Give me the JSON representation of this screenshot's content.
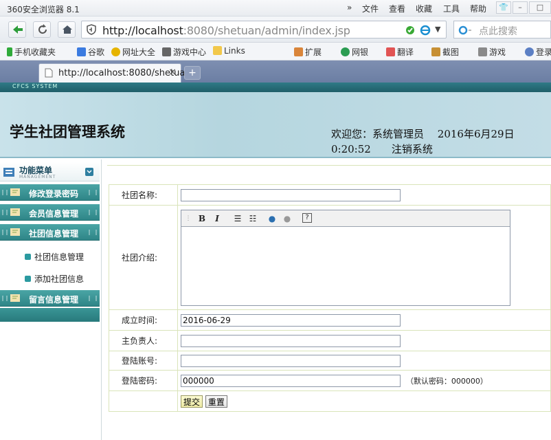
{
  "browser": {
    "app_title": "360安全浏览器 8.1",
    "menu": [
      "文件",
      "查看",
      "收藏",
      "工具",
      "帮助"
    ],
    "address_host": "http://localhost",
    "address_rest": ":8080/shetuan/admin/index.jsp",
    "search_placeholder": "点此搜索",
    "favorites": [
      "手机收藏夹",
      "谷歌",
      "网址大全",
      "游戏中心",
      "Links"
    ],
    "favorites_right": [
      "扩展",
      "网银",
      "翻译",
      "截图",
      "游戏",
      "登录"
    ],
    "tab_label": "http://localhost:8080/shetua",
    "tab_close": "×",
    "new_tab": "+"
  },
  "app": {
    "brand_strip": "CFCS SYSTEM",
    "title": "学生社团管理系统",
    "welcome_line1": "欢迎您：系统管理员　 2016年6月29日",
    "welcome_line2": "0:20:52　　注销系统"
  },
  "sidebar": {
    "header_title": "功能菜单",
    "header_sub": "MANAGEMENT",
    "menu": [
      {
        "label": "修改登录密码"
      },
      {
        "label": "会员信息管理"
      },
      {
        "label": "社团信息管理"
      },
      {
        "label": "留言信息管理"
      }
    ],
    "subitems": [
      "社团信息管理",
      "添加社团信息"
    ]
  },
  "form": {
    "name_label": "社团名称:",
    "name_value": "",
    "intro_label": "社团介绍:",
    "date_label": "成立时间:",
    "date_value": "2016-06-29",
    "leader_label": "主负责人:",
    "leader_value": "",
    "account_label": "登陆账号:",
    "account_value": "",
    "password_label": "登陆密码:",
    "password_value": "000000",
    "password_hint": "（默认密码：000000）",
    "submit_label": "提交",
    "reset_label": "重置"
  },
  "colors": {
    "menu_teal": "#3a9596",
    "header_bg": "#c2dde5",
    "form_border": "#d9e4b9"
  }
}
